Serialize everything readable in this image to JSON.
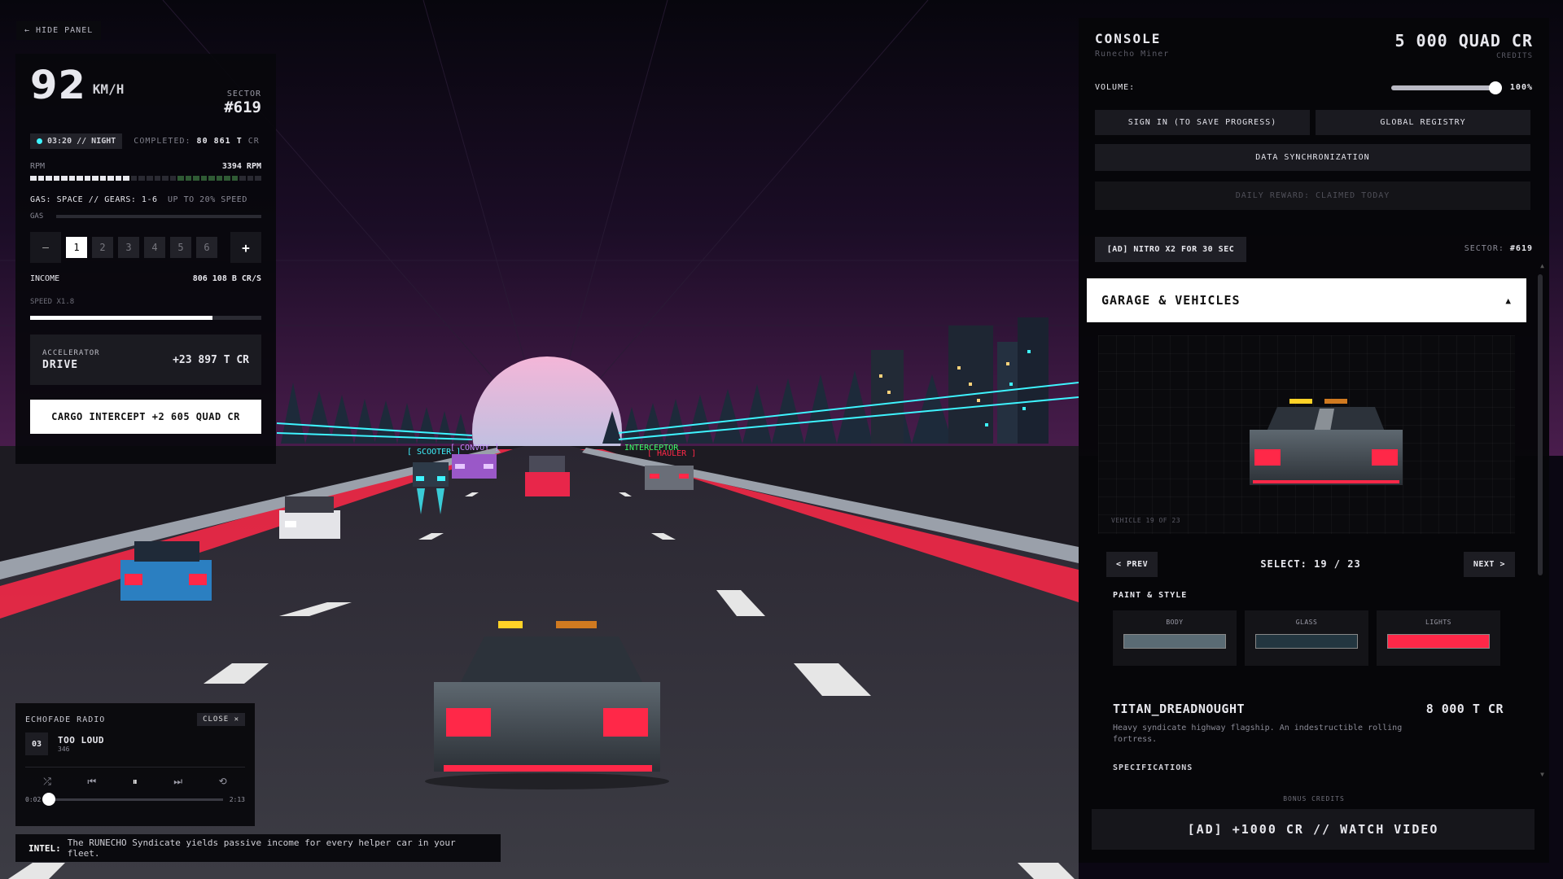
{
  "hide_panel": "← HIDE PANEL",
  "hud": {
    "speed": "92",
    "speed_unit": "KM/H",
    "sector_label": "SECTOR",
    "sector_value": "#619",
    "time": "03:20 // NIGHT",
    "completed_label": "COMPLETED:",
    "completed_value": "80 861 T",
    "completed_unit": "CR",
    "rpm_label": "RPM",
    "rpm_value": "3394 RPM",
    "rpm_fraction": 0.42,
    "gas_info": "GAS: SPACE // GEARS: 1-6",
    "gas_hint": "UP TO 20% SPEED",
    "gas_label": "GAS",
    "gear_minus": "–",
    "gear_plus": "+",
    "gears": [
      "1",
      "2",
      "3",
      "4",
      "5",
      "6"
    ],
    "active_gear": "1",
    "income_label": "INCOME",
    "income_value": "806 108 B CR/S",
    "speed_mult": "SPEED X1.8",
    "progress_fraction": 0.79,
    "accelerator_line1": "ACCELERATOR",
    "accelerator_line2": "DRIVE",
    "accelerator_value": "+23 897 T CR",
    "cargo_button": "CARGO INTERCEPT +2 605 QUAD CR"
  },
  "radio": {
    "title": "ECHOFADE RADIO",
    "close": "CLOSE ✕",
    "track_number": "03",
    "track_title": "TOO LOUD",
    "track_sub": "346",
    "time_current": "0:02",
    "time_total": "2:13",
    "seek_fraction": 0.01
  },
  "intel": {
    "label": "INTEL:",
    "text": "The RUNECHO Syndicate yields passive income for every helper car in your fleet."
  },
  "scene": {
    "labels": {
      "scooter": "[ SCOOTER ]",
      "convoy": "[ CONVOY ]",
      "hauler": "[ HAULER ]",
      "interceptor": "INTERCEPTOR"
    }
  },
  "console": {
    "title": "CONSOLE",
    "subtitle": "Runecho Miner",
    "credits_value": "5 000 QUAD CR",
    "credits_label": "CREDITS",
    "volume_label": "VOLUME:",
    "volume_value": "100%",
    "volume_fraction": 1.0,
    "sign_in": "SIGN IN (TO SAVE PROGRESS)",
    "global_registry": "GLOBAL REGISTRY",
    "data_sync": "DATA SYNCHRONIZATION",
    "daily_reward": "DAILY REWARD: CLAIMED TODAY",
    "nitro": "[AD] NITRO X2 FOR 30 SEC",
    "sector_label": "SECTOR:",
    "sector_value": "#619",
    "garage_title": "GARAGE & VEHICLES",
    "garage_toggle": "▲",
    "vehicle_count": "VEHICLE 19 OF 23",
    "prev": "< PREV",
    "next": "NEXT >",
    "select": "SELECT: 19 / 23",
    "paint_title": "PAINT & STYLE",
    "swatches": [
      {
        "label": "BODY",
        "color": "#5a6b74"
      },
      {
        "label": "GLASS",
        "color": "#233640"
      },
      {
        "label": "LIGHTS",
        "color": "#ff2848"
      }
    ],
    "vehicle_name": "TITAN_DREADNOUGHT",
    "vehicle_price": "8 000 T CR",
    "vehicle_desc": "Heavy syndicate highway flagship. An indestructible rolling fortress.",
    "specifications": "SPECIFICATIONS",
    "bonus_label": "BONUS CREDITS",
    "watch_button": "[AD] +1000 CR // WATCH VIDEO"
  },
  "colors": {
    "accent_cyan": "#3ef4ff",
    "accent_red": "#ff2848",
    "accent_magenta": "#ff3cc8",
    "sky_top": "#0b0713",
    "sky_horizon": "#3a1642"
  }
}
